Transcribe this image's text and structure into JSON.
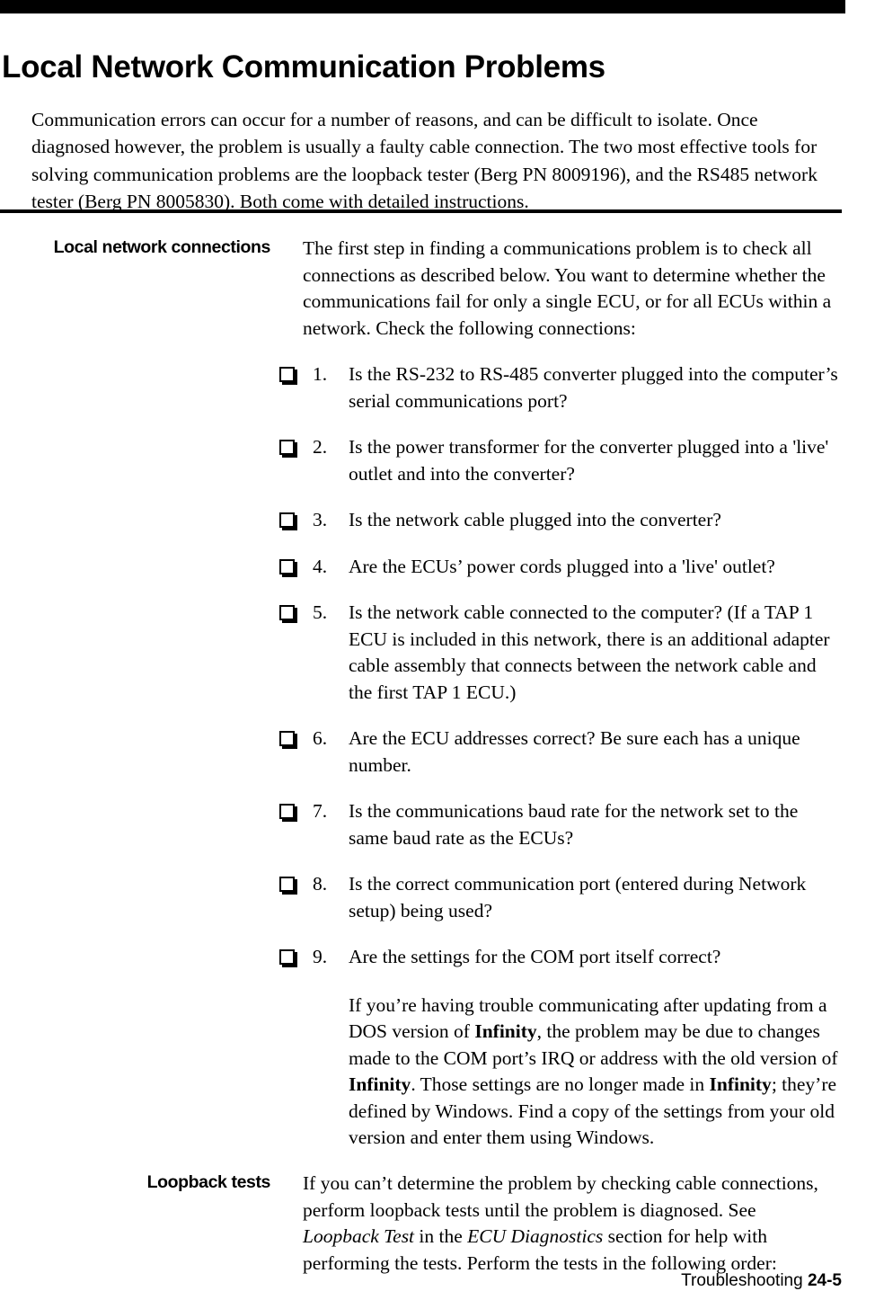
{
  "page": {
    "title": "Local Network Communication Problems",
    "intro": "Communication errors can occur for a number of reasons, and can be difficult to isolate. Once diagnosed however, the problem is usually a faulty cable connection. The two most effective tools for solving communication problems are the loopback tester (Berg PN 8009196), and the RS485 network tester (Berg PN 8005830). Both come with detailed instructions."
  },
  "sections": {
    "local_network_connections": {
      "label": "Local network connections",
      "intro_para": "The first step in finding a communications problem is to check all connections as described below. You want to determine whether the communications fail for only a single ECU, or for all ECUs within a network. Check the following connections:",
      "items": [
        {
          "num": "1.",
          "text": "Is the RS-232 to RS-485 converter plugged into the computer’s serial communications port?"
        },
        {
          "num": "2.",
          "text": "Is the power transformer for the converter plugged into a 'live' outlet and into the converter?"
        },
        {
          "num": "3.",
          "text": "Is the network cable plugged into the converter?"
        },
        {
          "num": "4.",
          "text": "Are the ECUs’ power cords plugged into a 'live' outlet?"
        },
        {
          "num": "5.",
          "text": "Is the network cable connected to the computer? (If a TAP 1  ECU is included in this network, there is an additional adapter cable assembly that connects between the network cable and the first TAP 1 ECU.)"
        },
        {
          "num": "6.",
          "text": "Are the ECU addresses correct? Be sure each has a unique number."
        },
        {
          "num": "7.",
          "text": "Is the communications baud rate for the network set to the same baud rate as the ECUs?"
        },
        {
          "num": "8.",
          "text": "Is the correct communication port (entered during Network setup) being used?"
        },
        {
          "num": "9.",
          "text": "Are the settings for the COM port itself correct?"
        }
      ],
      "note": {
        "part1": "If you’re having trouble communicating after updating from a DOS version of ",
        "bold1": "Infinity",
        "part2": ", the problem may be due to changes made to the COM port’s IRQ or address with the old version of ",
        "bold2": "Infinity",
        "part3": ". Those settings are no longer made in ",
        "bold3": "Infinity",
        "part4": "; they’re defined by Windows. Find a copy of the settings from your old version and enter them using Windows."
      }
    },
    "loopback_tests": {
      "label": "Loopback tests",
      "para": {
        "part1": "If you can’t determine the problem by checking cable connections, perform loopback tests until the problem is diagnosed. See ",
        "italic1": "Loopback Test",
        "part2": " in the ",
        "italic2": "ECU Diagnostics",
        "part3": " section for help with performing the tests. Perform the tests in the following order:"
      }
    }
  },
  "footer": {
    "section_name": "Troubleshooting ",
    "page_number": "24-5"
  },
  "icons": {
    "checkbox": "checkbox-icon"
  },
  "colors": {
    "ink": "#000000",
    "paper": "#ffffff"
  }
}
